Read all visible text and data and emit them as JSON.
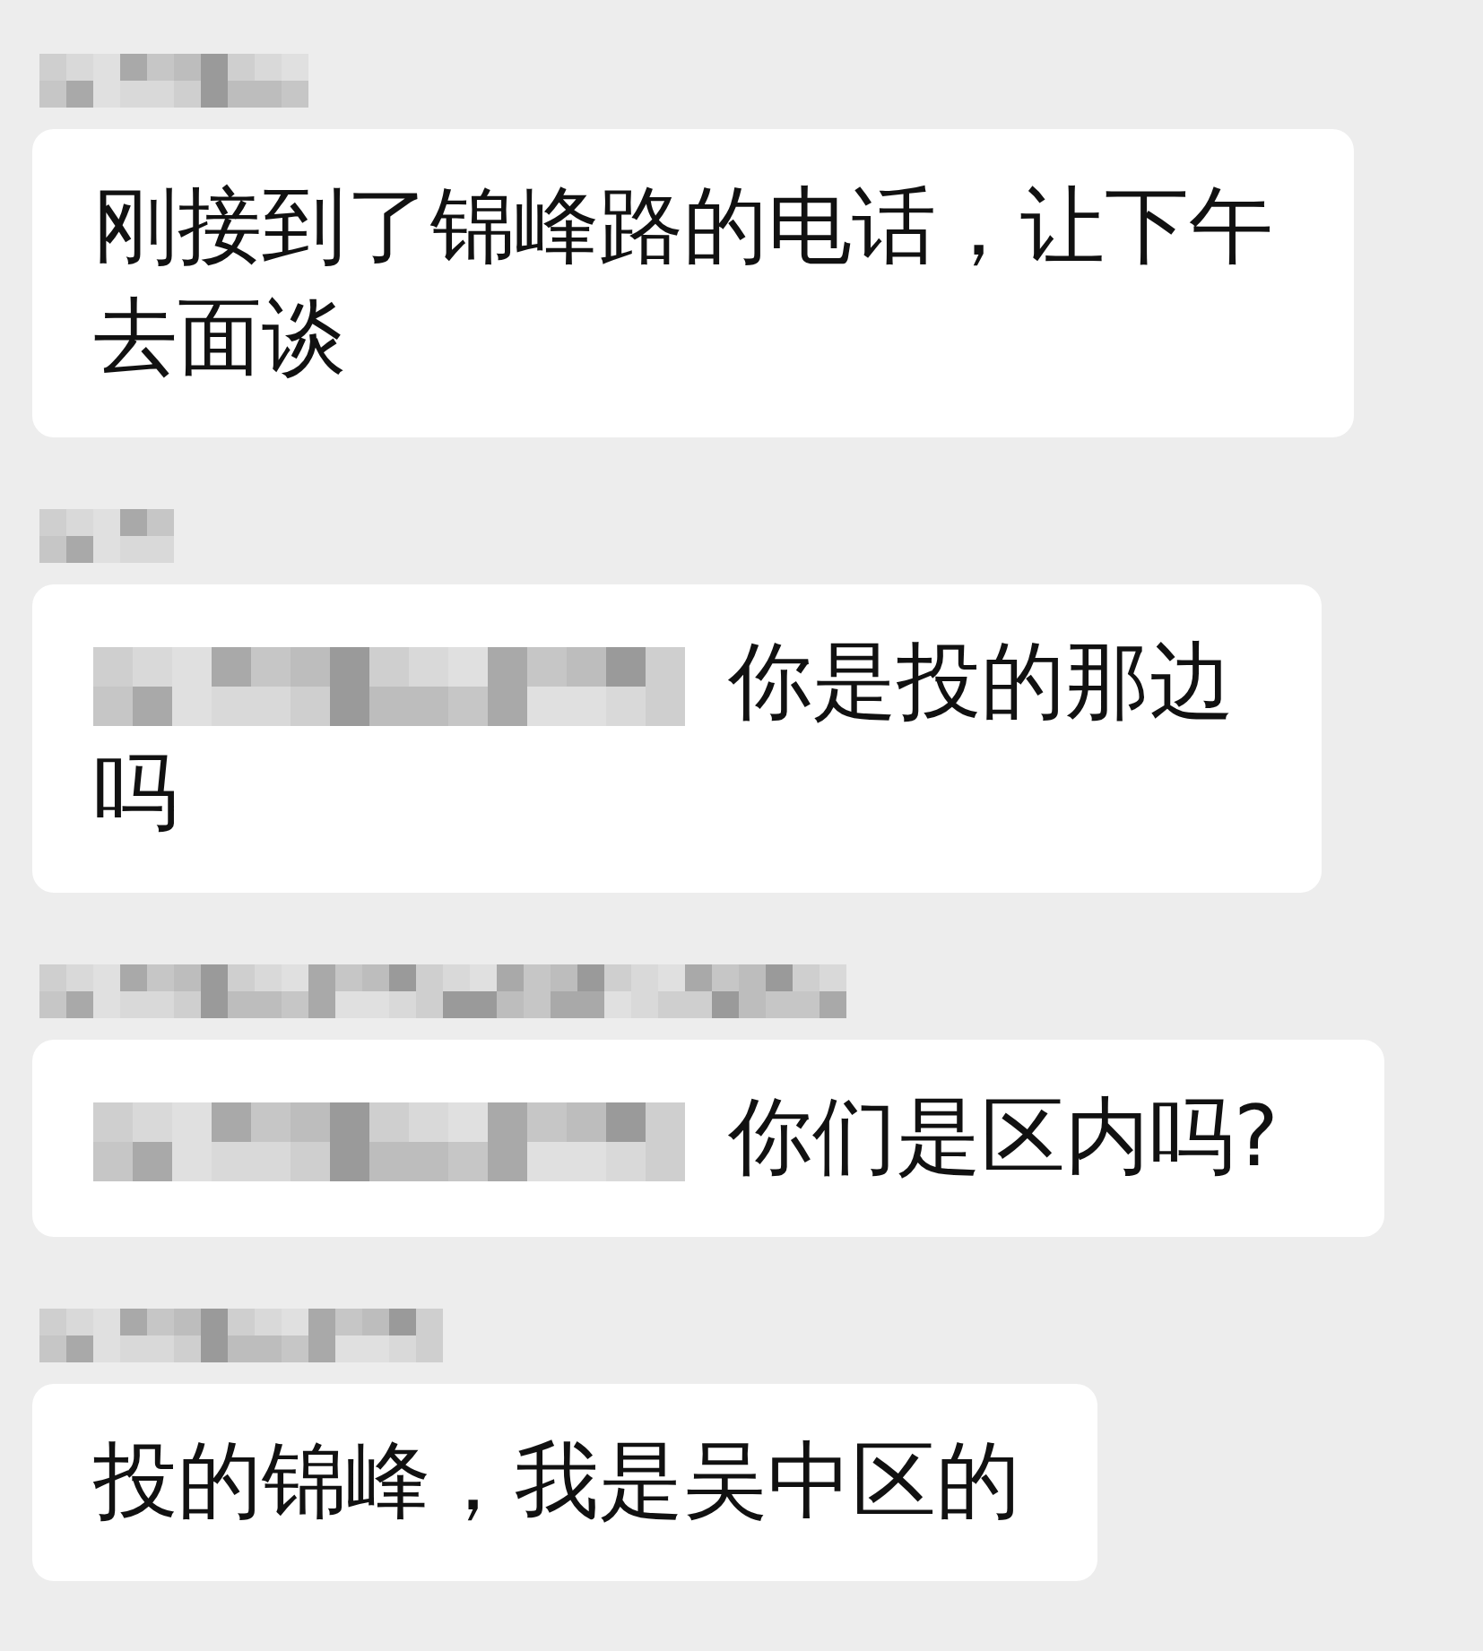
{
  "messages": [
    {
      "redacted_prefix": false,
      "text": "刚接到了锦峰路的电话，让下午去面谈"
    },
    {
      "redacted_prefix": true,
      "text": "你是投的那边吗"
    },
    {
      "redacted_prefix": true,
      "text": "你们是区内吗?"
    },
    {
      "redacted_prefix": false,
      "text": "投的锦峰，我是吴中区的"
    }
  ]
}
